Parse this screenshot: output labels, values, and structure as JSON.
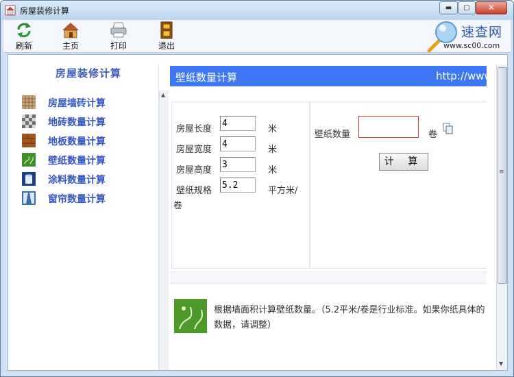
{
  "window": {
    "title": "房屋装修计算"
  },
  "toolbar": {
    "refresh": "刷新",
    "home": "主页",
    "print": "打印",
    "exit": "退出"
  },
  "logo": {
    "title": "速查网",
    "url": "www.sc00.com"
  },
  "sidebar": {
    "title": "房屋装修计算",
    "items": [
      {
        "label": "房屋墙砖计算",
        "icon": "brick-wall-icon"
      },
      {
        "label": "地砖数量计算",
        "icon": "checker-tile-icon"
      },
      {
        "label": "地板数量计算",
        "icon": "wood-floor-icon"
      },
      {
        "label": "壁纸数量计算",
        "icon": "wallpaper-icon"
      },
      {
        "label": "涂料数量计算",
        "icon": "paint-bucket-icon"
      },
      {
        "label": "窗帘数量计算",
        "icon": "curtain-icon"
      }
    ]
  },
  "main": {
    "title": "壁纸数量计算",
    "url": "http://www",
    "fields": [
      {
        "label": "房屋长度",
        "value": "4",
        "unit": "米"
      },
      {
        "label": "房屋宽度",
        "value": "4",
        "unit": "米"
      },
      {
        "label": "房屋高度",
        "value": "3",
        "unit": "米"
      },
      {
        "label": "壁纸规格",
        "value": "5.2",
        "unit": "平方米/",
        "unit_wrap": "卷"
      }
    ],
    "result": {
      "label": "壁纸数量",
      "value": "",
      "unit": "卷"
    },
    "calc_button": "计 算",
    "note": "根据墙面积计算壁纸数量。（5.2平米/卷是行业标准。如果你纸具体的数据，请调整）"
  },
  "colors": {
    "header_blue": "#3d77f6",
    "link_blue": "#3557c0",
    "result_border": "#cc3333"
  }
}
